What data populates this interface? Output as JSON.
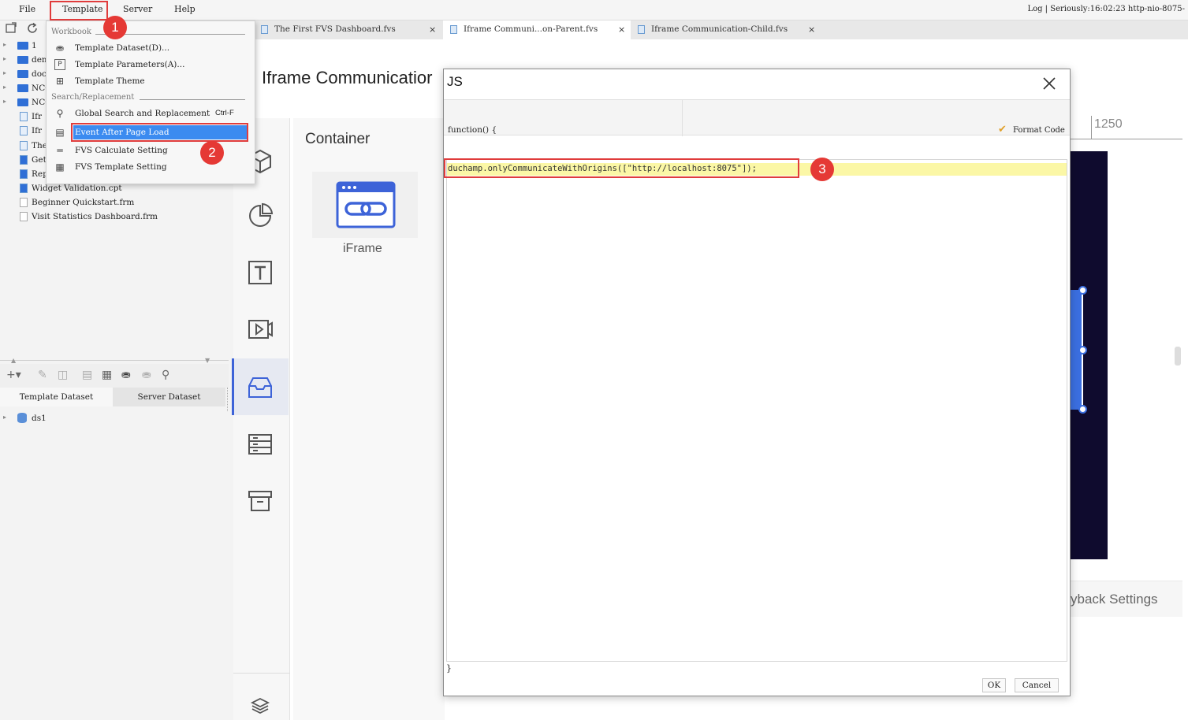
{
  "menubar": {
    "items": [
      "File",
      "Template",
      "Server",
      "Help"
    ],
    "status": "Log | Seriously:16:02:23 http-nio-8075-"
  },
  "tabs": [
    {
      "label": "The First FVS Dashboard.fvs"
    },
    {
      "label": "Iframe Communi...on-Parent.fvs"
    },
    {
      "label": "Iframe Communication-Child.fvs"
    }
  ],
  "tree": {
    "items": [
      "1",
      "dem",
      "doc",
      "NCO",
      "NCO",
      "Ifr",
      "Ifr",
      "The",
      "Get",
      "Rep",
      "Widget Validation.cpt",
      "Beginner Quickstart.frm",
      "Visit Statistics Dashboard.frm"
    ]
  },
  "dataset": {
    "tabs": [
      "Template Dataset",
      "Server Dataset"
    ],
    "items": [
      "ds1"
    ]
  },
  "dropdown": {
    "section_workbook": "Workbook",
    "section_search": "Search/Replacement",
    "items": [
      {
        "label": "Template Dataset(D)...",
        "icon": "database-icon"
      },
      {
        "label": "Template Parameters(A)...",
        "icon": "parameter-icon"
      },
      {
        "label": "Template Theme",
        "icon": "theme-grid-icon"
      },
      {
        "label": "Global Search and Replacement",
        "shortcut": "Ctrl-F",
        "icon": "search-icon"
      },
      {
        "label": "Event After Page Load",
        "icon": "event-icon"
      },
      {
        "label": "FVS Calculate Setting",
        "icon": "calculate-icon"
      },
      {
        "label": "FVS Template Setting",
        "icon": "settings-icon"
      }
    ]
  },
  "canvas": {
    "title": "Iframe Communicatior",
    "container_label": "Container",
    "iframe_label": "iFrame",
    "ruler_label": "1250",
    "playback_label": "yback Settings"
  },
  "dialog": {
    "title": "JS",
    "function_header": "function() {",
    "format_code": "Format Code",
    "code": "duchamp.onlyCommunicateWithOrigins([\"http://localhost:8075\"]);",
    "closing_brace": "}",
    "ok": "OK",
    "cancel": "Cancel"
  },
  "callouts": [
    "1",
    "2",
    "3"
  ],
  "colors": {
    "highlight": "#3b8bf0",
    "callout_red": "#e53935",
    "code_line": "#fbf7a6",
    "dark_panel": "#0f0b2e"
  }
}
